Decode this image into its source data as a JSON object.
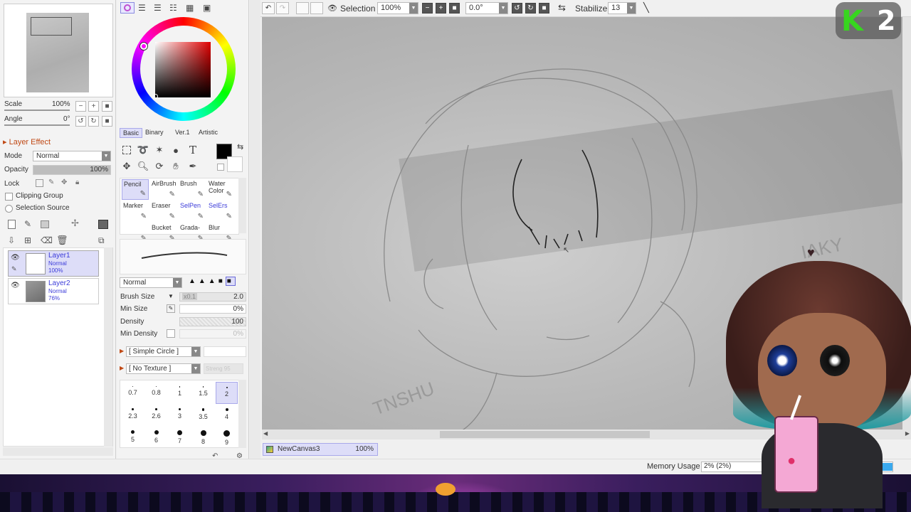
{
  "navigator": {
    "scale_label": "Scale",
    "scale_value": "100%",
    "angle_label": "Angle",
    "angle_value": "0°"
  },
  "layer_panel": {
    "effect_title": "Layer Effect",
    "mode_label": "Mode",
    "mode_value": "Normal",
    "opacity_label": "Opacity",
    "opacity_value": "100%",
    "opacity_fraction": 1.0,
    "lock_label": "Lock",
    "clipping_group": "Clipping Group",
    "selection_source": "Selection Source",
    "layers": [
      {
        "name": "Layer1",
        "mode": "Normal",
        "opacity": "100%"
      },
      {
        "name": "Layer2",
        "mode": "Normal",
        "opacity": "76%"
      }
    ]
  },
  "color_panel": {
    "tabs": [
      "Basic",
      "Binary",
      "Ver.1",
      "Artistic"
    ]
  },
  "brush_panel": {
    "tools": [
      {
        "label": "Pencil",
        "selected": true,
        "blue": false
      },
      {
        "label": "AirBrush",
        "selected": false,
        "blue": false
      },
      {
        "label": "Brush",
        "selected": false,
        "blue": false
      },
      {
        "label": "Water Color",
        "selected": false,
        "blue": false
      },
      {
        "label": "Marker",
        "selected": false,
        "blue": false
      },
      {
        "label": "Eraser",
        "selected": false,
        "blue": false
      },
      {
        "label": "SelPen",
        "selected": false,
        "blue": true
      },
      {
        "label": "SelErs",
        "selected": false,
        "blue": true
      },
      {
        "label": "",
        "selected": false,
        "blue": false
      },
      {
        "label": "Bucket",
        "selected": false,
        "blue": false
      },
      {
        "label": "Grada-",
        "selected": false,
        "blue": false
      },
      {
        "label": "Blur",
        "selected": false,
        "blue": false
      }
    ],
    "blend_mode": "Normal",
    "brush_size_label": "Brush Size",
    "brush_size_multiplier": "x0.1",
    "brush_size_value": "2.0",
    "min_size_label": "Min Size",
    "min_size_value": "0%",
    "density_label": "Density",
    "density_value": "100",
    "min_density_label": "Min Density",
    "min_density_value": "0%",
    "shape": "[ Simple Circle ]",
    "texture": "[ No Texture ]",
    "texture_strength": "Streng 95",
    "size_presets": [
      "0.7",
      "0.8",
      "1",
      "1.5",
      "2",
      "2.3",
      "2.6",
      "3",
      "3.5",
      "4",
      "5",
      "6",
      "7",
      "8",
      "9"
    ],
    "selected_preset": "2"
  },
  "toolbar": {
    "selection_label": "Selection",
    "zoom_value": "100%",
    "angle_value": "0.0°",
    "stabilizer_label": "Stabilizer",
    "stabilizer_value": "13"
  },
  "canvas_tab": {
    "name": "NewCanvas3",
    "zoom": "100%"
  },
  "status": {
    "memory_label": "Memory Usage",
    "memory_value": "2% (2%)"
  },
  "overlay": {
    "logo_text": "2",
    "accent": "#37d61f"
  }
}
